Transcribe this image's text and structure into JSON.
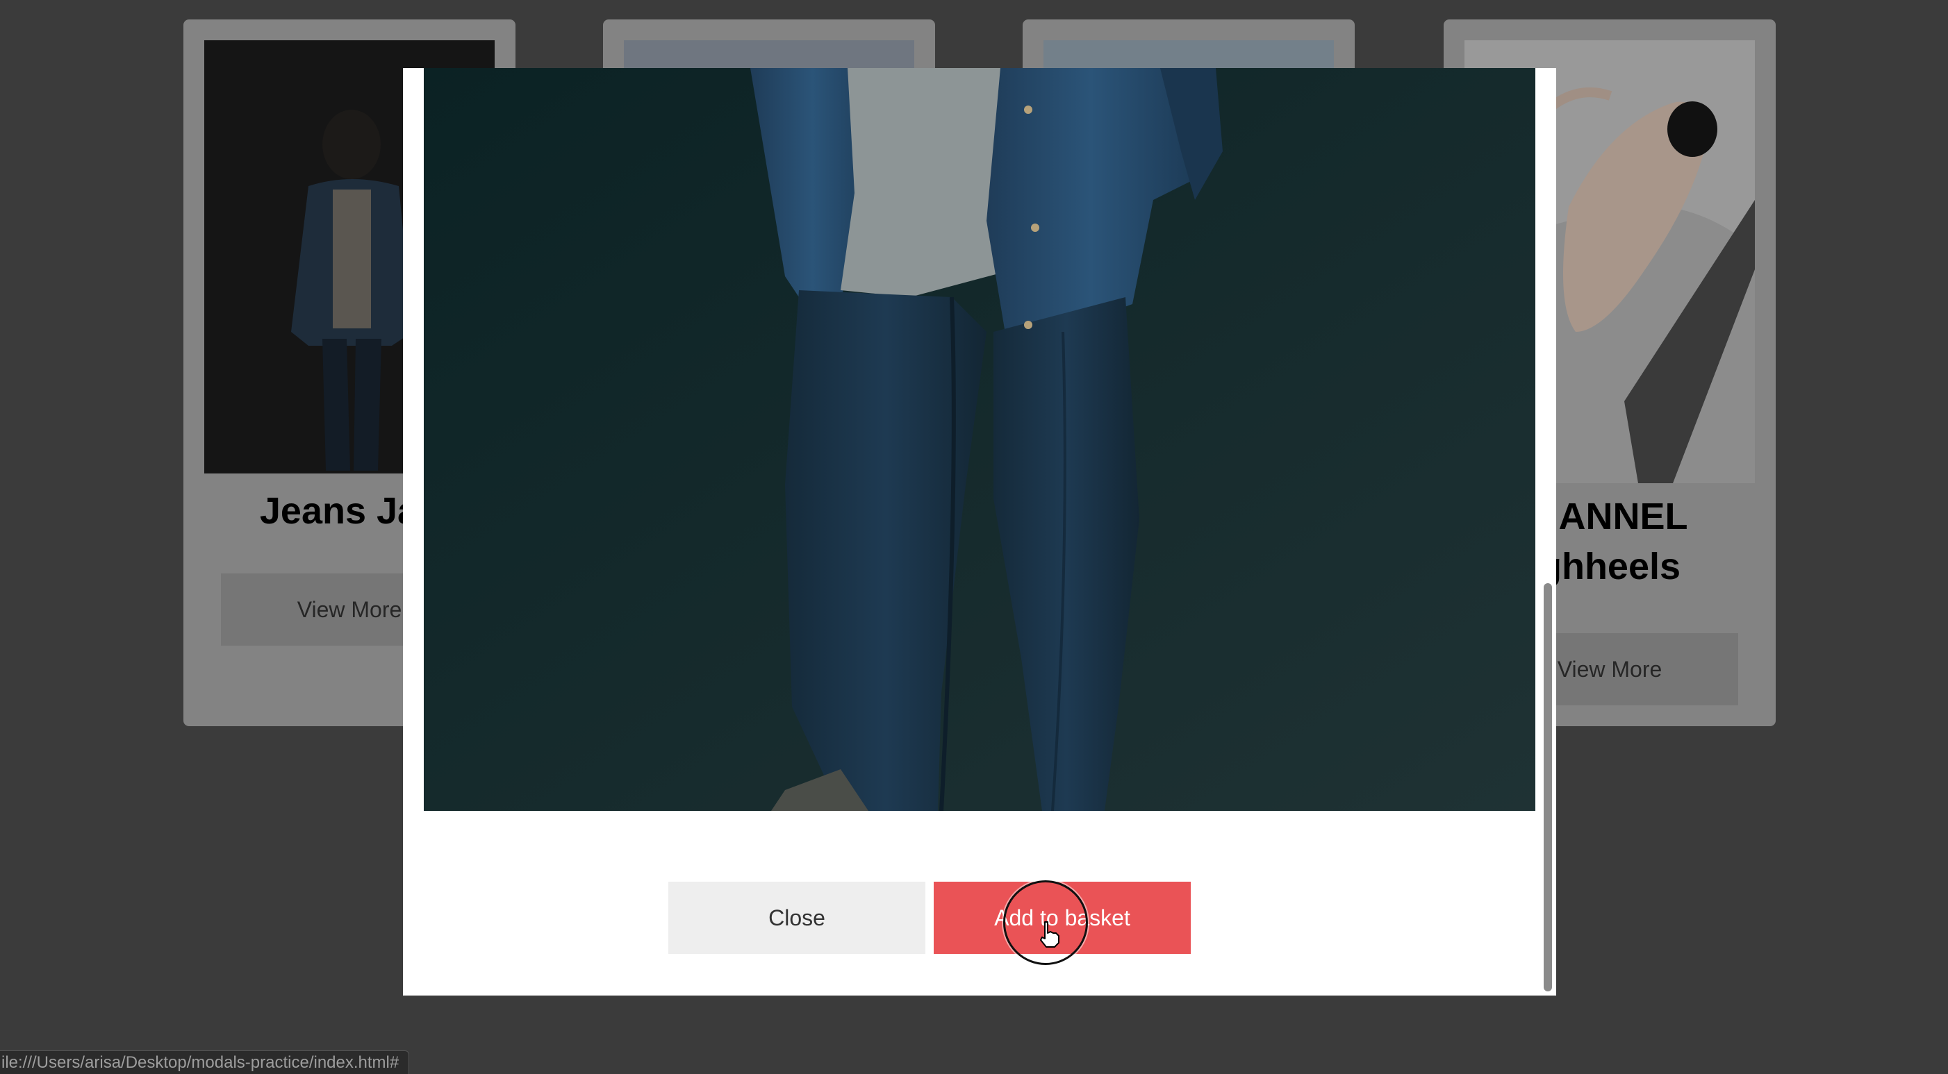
{
  "products": [
    {
      "title": "Jeans Jac",
      "button_label": "View More"
    },
    {
      "title": "",
      "button_label": ""
    },
    {
      "title": "",
      "button_label": ""
    },
    {
      "title_line1": "HANNEL",
      "title_line2": "ghheels",
      "button_label": "View More"
    }
  ],
  "modal": {
    "close_label": "Close",
    "add_label": "Add to basket"
  },
  "statusbar": {
    "url": "ile:///Users/arisa/Desktop/modals-practice/index.html#"
  },
  "colors": {
    "overlay": "#3b3b3b",
    "add_button": "#ea5356",
    "close_button": "#eeeeee"
  }
}
